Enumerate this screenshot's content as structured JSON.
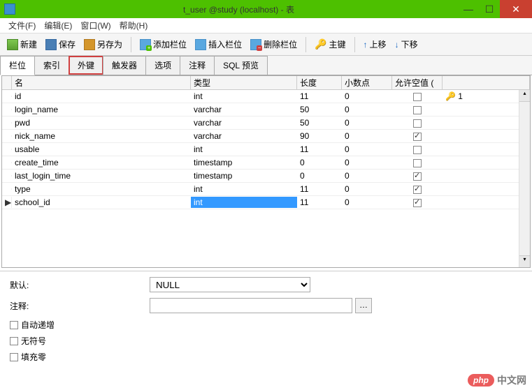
{
  "window": {
    "title": "t_user @study (localhost) - 表"
  },
  "menubar": {
    "file": "文件(F)",
    "edit": "编辑(E)",
    "window": "窗口(W)",
    "help": "帮助(H)"
  },
  "toolbar": {
    "new": "新建",
    "save": "保存",
    "saveas": "另存为",
    "addfield": "添加栏位",
    "insertfield": "插入栏位",
    "deletefield": "删除栏位",
    "primarykey": "主键",
    "moveup": "上移",
    "movedown": "下移"
  },
  "tabs": {
    "fields": "栏位",
    "indexes": "索引",
    "foreignkeys": "外键",
    "triggers": "触发器",
    "options": "选项",
    "comment": "注释",
    "sqlpreview": "SQL 预览"
  },
  "grid": {
    "headers": {
      "name": "名",
      "type": "类型",
      "length": "长度",
      "decimals": "小数点",
      "allownull": "允许空值 (",
      "key": ""
    },
    "rows": [
      {
        "name": "id",
        "type": "int",
        "length": "11",
        "decimals": "0",
        "allownull": false,
        "key": "1",
        "selected": false,
        "marker": ""
      },
      {
        "name": "login_name",
        "type": "varchar",
        "length": "50",
        "decimals": "0",
        "allownull": false,
        "key": "",
        "selected": false,
        "marker": ""
      },
      {
        "name": "pwd",
        "type": "varchar",
        "length": "50",
        "decimals": "0",
        "allownull": false,
        "key": "",
        "selected": false,
        "marker": ""
      },
      {
        "name": "nick_name",
        "type": "varchar",
        "length": "90",
        "decimals": "0",
        "allownull": true,
        "key": "",
        "selected": false,
        "marker": ""
      },
      {
        "name": "usable",
        "type": "int",
        "length": "11",
        "decimals": "0",
        "allownull": false,
        "key": "",
        "selected": false,
        "marker": ""
      },
      {
        "name": "create_time",
        "type": "timestamp",
        "length": "0",
        "decimals": "0",
        "allownull": false,
        "key": "",
        "selected": false,
        "marker": ""
      },
      {
        "name": "last_login_time",
        "type": "timestamp",
        "length": "0",
        "decimals": "0",
        "allownull": true,
        "key": "",
        "selected": false,
        "marker": ""
      },
      {
        "name": "type",
        "type": "int",
        "length": "11",
        "decimals": "0",
        "allownull": true,
        "key": "",
        "selected": false,
        "marker": ""
      },
      {
        "name": "school_id",
        "type": "int",
        "length": "11",
        "decimals": "0",
        "allownull": true,
        "key": "",
        "selected": true,
        "marker": "▶"
      }
    ]
  },
  "props": {
    "default_label": "默认:",
    "default_value": "NULL",
    "comment_label": "注释:",
    "comment_value": "",
    "autoincrement": "自动递增",
    "unsigned": "无符号",
    "zerofill": "填充零"
  },
  "watermark": {
    "badge": "php",
    "text": "中文网"
  }
}
